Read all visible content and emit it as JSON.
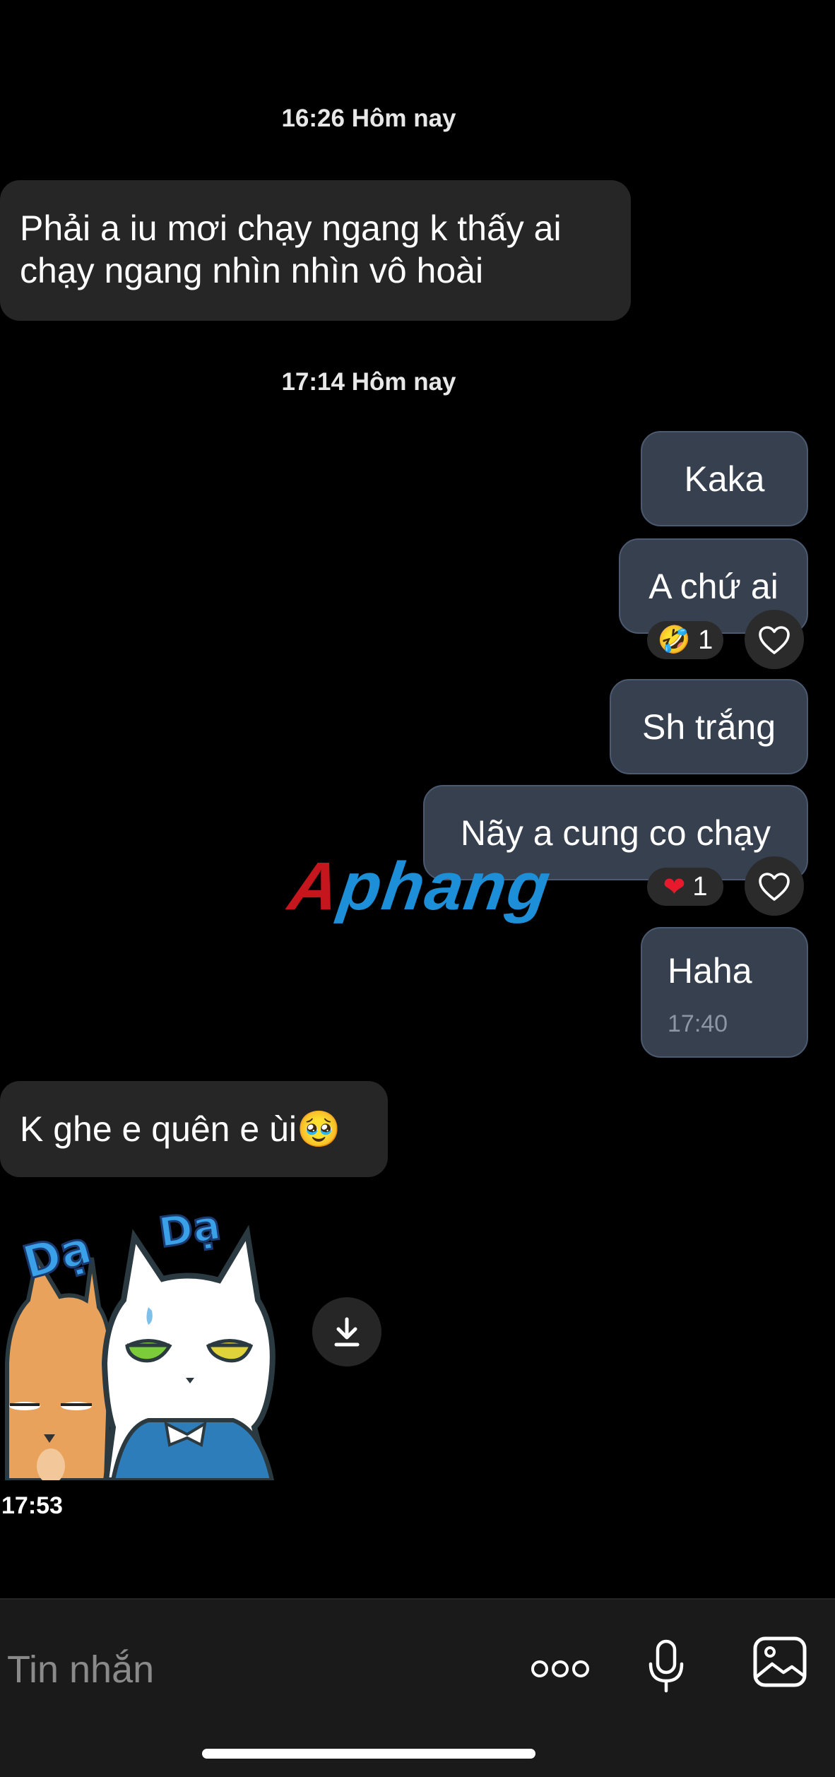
{
  "conversation": {
    "timestamp_1": "16:26 Hôm nay",
    "timestamp_2": "17:14 Hôm nay",
    "messages": [
      {
        "text_line1": "Phải a iu mơi chạy ngang k thấy ai",
        "text_line2": "chạy ngang nhìn nhìn vô hoài"
      },
      {
        "text": "Kaka"
      },
      {
        "text": "A chứ ai",
        "reaction_count": "1"
      },
      {
        "text": "Sh trắng"
      },
      {
        "text": "Nãy a cung co chạy",
        "reaction_count": "1"
      },
      {
        "text": "Haha",
        "time": "17:40"
      },
      {
        "text": "K ghe e quên e ùi🥹"
      }
    ],
    "sticker": {
      "lettering_left": "Dạ",
      "lettering_right": "Dạ",
      "time": "17:53"
    }
  },
  "watermark": {
    "text": "Aphang"
  },
  "composer": {
    "placeholder": "Tin nhắn"
  },
  "icons": [
    "heart-outline-icon",
    "download-icon",
    "more-dots-icon",
    "microphone-icon",
    "image-icon"
  ],
  "colors": {
    "background": "#000000",
    "incoming_bubble": "#262626",
    "outgoing_bubble": "#36404f",
    "outgoing_border": "#4b5a70",
    "composer_bg": "#1a1a1a"
  }
}
